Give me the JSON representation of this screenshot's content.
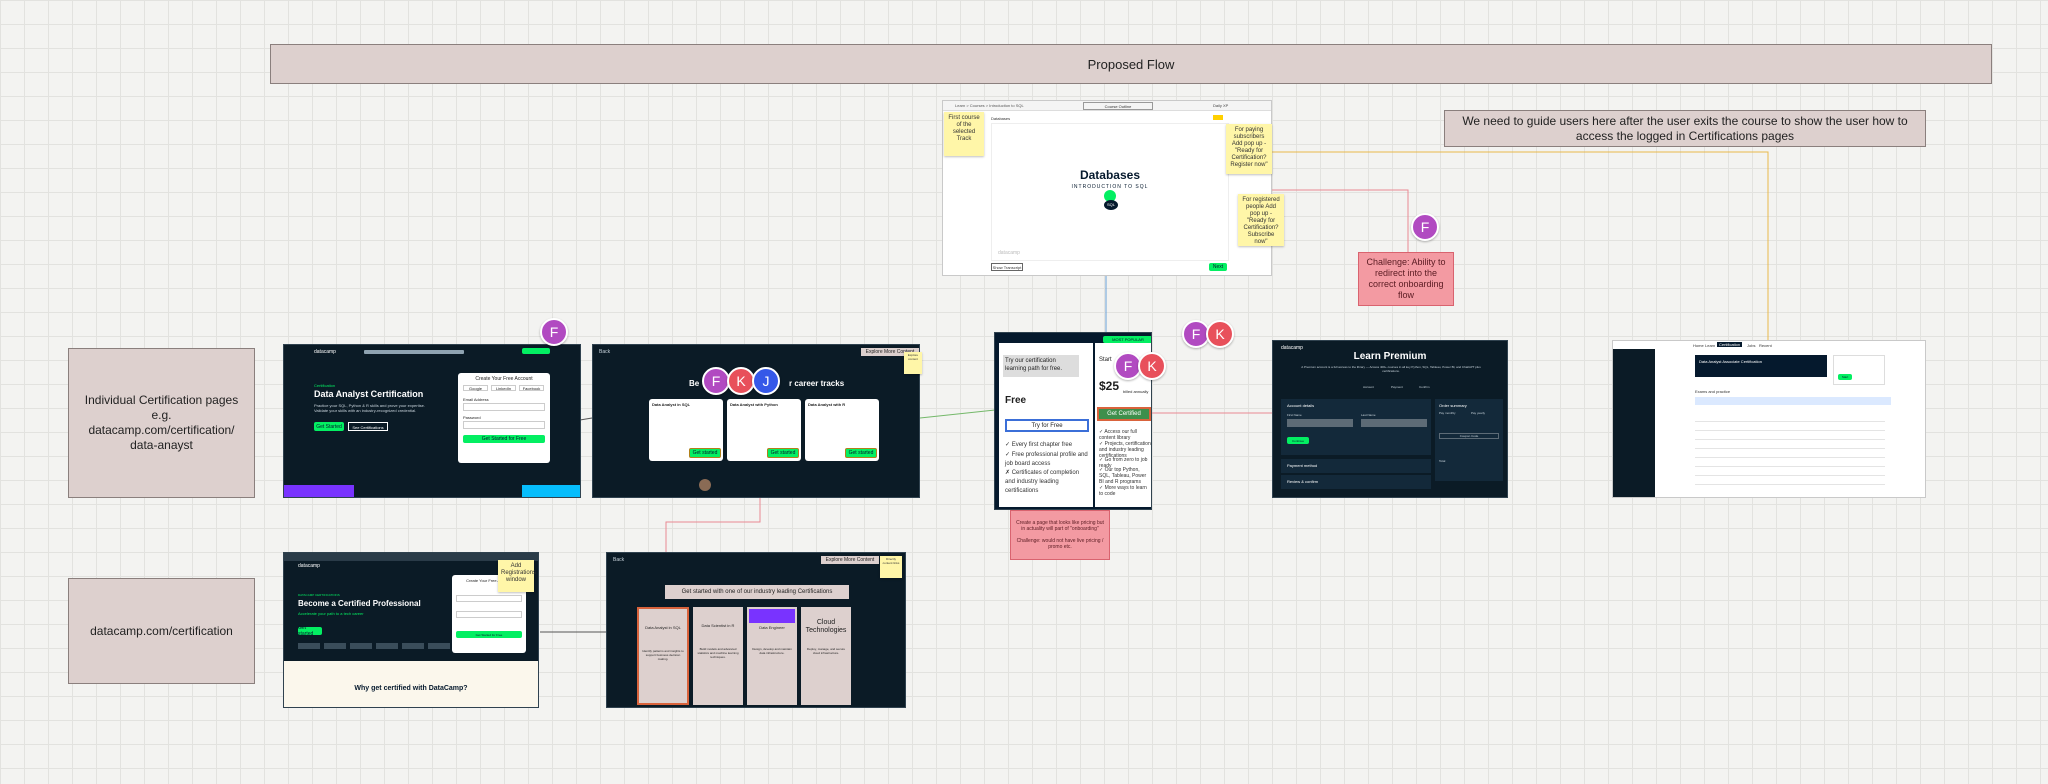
{
  "flow_title": "Proposed Flow",
  "guide_note": "We need to guide users here after the user exits the course to show the user how to access the logged in Certifications pages",
  "left_labels": {
    "individual": "Individual Certification pages\ne.g.\ndatacamp.com/certification/\ndata-anayst",
    "cert_root": "datacamp.com/certification"
  },
  "stickies": {
    "first_course": "First course of the selected Track",
    "paying": "For paying subscribers Add pop up - \"Ready for Certification? Register now\"",
    "registered": "For registered people Add pop up - \"Ready for Certification? Subscribe now\"",
    "add_registrations": "Add Registrations window",
    "explore_note": "Explore content",
    "explore_note_2": "Directly content links"
  },
  "challenge_box": "Challenge: Ability to redirect into the correct onboarding flow",
  "pricing_note": "Create a page that looks like pricing but in actuality will part of \"onboarding\"\n\nChallenge: would not have live pricing / promo etc.",
  "course_frame": {
    "breadcrumb": "Learn > Courses > Introduction to SQL",
    "course_outline_btn": "Course Outline",
    "daily_xp": "Daily XP",
    "tab": "Databases",
    "heading": "Databases",
    "subheading": "INTRODUCTION TO SQL",
    "badge": "SQL",
    "watermark": "datacamp",
    "show_transcript": "Show Transcript",
    "next_btn": "Next"
  },
  "data_analyst_page": {
    "logo": "datacamp",
    "eyebrow": "Certification",
    "heading": "Data Analyst Certification",
    "body": "Practice your SQL, Python & R skills and prove your expertise. Validate your skills with an industry-recognized credential.",
    "primary_btn": "Get Started",
    "secondary_btn": "See Certifications",
    "form_title": "Create Your Free Account",
    "google": "Google",
    "linkedin": "LinkedIn",
    "facebook": "Facebook",
    "email_label": "Email Address",
    "password_label": "Password",
    "submit": "Get Started for Free"
  },
  "tracks_page": {
    "back": "Back",
    "explore": "Explore More Content",
    "heading_left": "Be",
    "heading_right": "r career tracks",
    "cards": [
      {
        "title": "Data Analyst in SQL",
        "btn": "Get started"
      },
      {
        "title": "Data Analyst with Python",
        "btn": "Get started"
      },
      {
        "title": "Data Analyst with R",
        "btn": "Get started"
      }
    ]
  },
  "pricing_frame": {
    "banner": "MOST POPULAR",
    "free_intro": "Try our certification learning path for free.",
    "free_title": "Free",
    "free_btn": "Try for Free",
    "free_list": [
      "Every first chapter free",
      "Free professional profile and job board access",
      "Certificates of completion and industry leading certifications"
    ],
    "paid_intro": "Start",
    "paid_price": "$25",
    "paid_note": "billed annually",
    "paid_btn": "Get Certified",
    "paid_list": [
      "Access our full content library",
      "Projects, certification and industry leading certifications",
      "Go from zero to job ready",
      "Our top Python, SQL, Tableau, Power BI and R programs",
      "More ways to learn to code"
    ]
  },
  "premium_frame": {
    "logo": "datacamp",
    "title": "Learn Premium",
    "subtitle": "A Premium account is a full access to the library — Access 400+ courses in all key Python, SQL, Tableau, Power BI, and ChatGPT plus certifications.",
    "steps": [
      "Account",
      "Payment",
      "Confirm"
    ],
    "account_details": "Account details",
    "first_name": "First Name",
    "last_name": "Last Name",
    "continue_btn": "Continue",
    "payment_method": "Payment method",
    "review": "Review & confirm",
    "order_summary": "Order summary",
    "pay_monthly": "Pay monthly",
    "pay_yearly": "Pay yearly",
    "promo": "Coupon Code",
    "total": "Total"
  },
  "dashboard_frame": {
    "tabs": [
      "Home",
      "Learn",
      "Certification",
      "Jobs",
      "Recent"
    ],
    "panel_title": "Data Analyst Associate Certification",
    "sub_title": "Exams and practice",
    "start_btn": "Start"
  },
  "cert_root_page": {
    "logo": "datacamp",
    "eyebrow": "DATACAMP CERTIFICATIONS",
    "heading": "Become a Certified Professional",
    "sub": "Accelerate your path to a tech career",
    "cta": "Get started",
    "form_title": "Create Your Free Account",
    "submit": "Get Started for Free",
    "why": "Why get certified with DataCamp?"
  },
  "industry_page": {
    "back": "Back",
    "explore": "Explore More Content",
    "heading": "Get started with one of our industry leading Certifications",
    "cards": [
      {
        "title": "Data Analyst in SQL",
        "body": "Identify patterns and insights to support business decision making."
      },
      {
        "title": "Data Scientist in R",
        "body": "Build models and advanced statistics and machine learning techniques."
      },
      {
        "title": "Data Engineer",
        "body": "Design, develop and maintain data infrastructure."
      },
      {
        "title": "Cloud Technologies",
        "body": "Deploy, manage, and secure cloud infrastructure."
      }
    ]
  },
  "avatars": {
    "f": "F",
    "k": "K",
    "j": "J"
  },
  "colors": {
    "dc_navy": "#05192d",
    "dc_green": "#03ef62",
    "taupe": "#ddd0ce",
    "sticky": "#fff6a8",
    "pink": "#f39aa2"
  }
}
